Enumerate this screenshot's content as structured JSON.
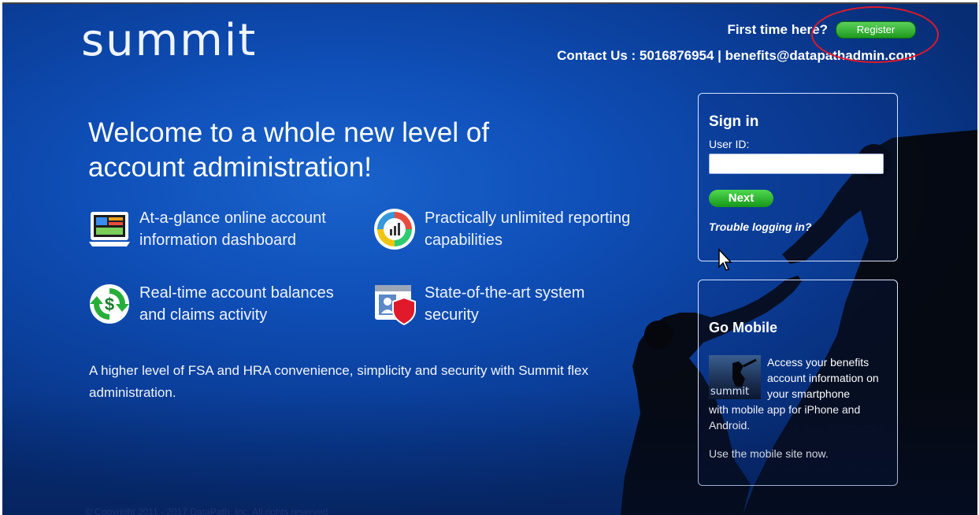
{
  "header": {
    "logo_text": "summit",
    "first_time_label": "First time here?",
    "register_label": "Register",
    "contact_label": "Contact Us : 5016876954 | benefits@datapathadmin.com"
  },
  "hero": {
    "headline": "Welcome to a whole new level of account administration!",
    "features": [
      {
        "icon": "dashboard-icon",
        "text": "At-a-glance online account information dashboard"
      },
      {
        "icon": "reporting-chart-icon",
        "text": "Practically unlimited reporting capabilities"
      },
      {
        "icon": "dollar-refresh-icon",
        "text": "Real-time account balances and claims activity"
      },
      {
        "icon": "security-shield-icon",
        "text": "State-of-the-art system security"
      }
    ],
    "tagline": "A higher level of FSA and HRA convenience, simplicity and security with Summit flex administration."
  },
  "signin": {
    "title": "Sign in",
    "user_id_label": "User ID:",
    "user_id_value": "",
    "next_label": "Next",
    "trouble_label": "Trouble logging in?"
  },
  "mobile": {
    "title": "Go Mobile",
    "thumb_logo": "summit",
    "desc_right": "Access your benefits account information on your smartphone",
    "desc_full": "with mobile app for iPhone and Android.",
    "site_link": "Use the mobile site now."
  },
  "footer": {
    "copyright": "© Copyright 2011 - 2017 DataPath, Inc. All rights reserved."
  },
  "colors": {
    "background": "#0f4fb8",
    "button_green": "#1e9a1e",
    "highlight_ring": "#e0192b"
  }
}
